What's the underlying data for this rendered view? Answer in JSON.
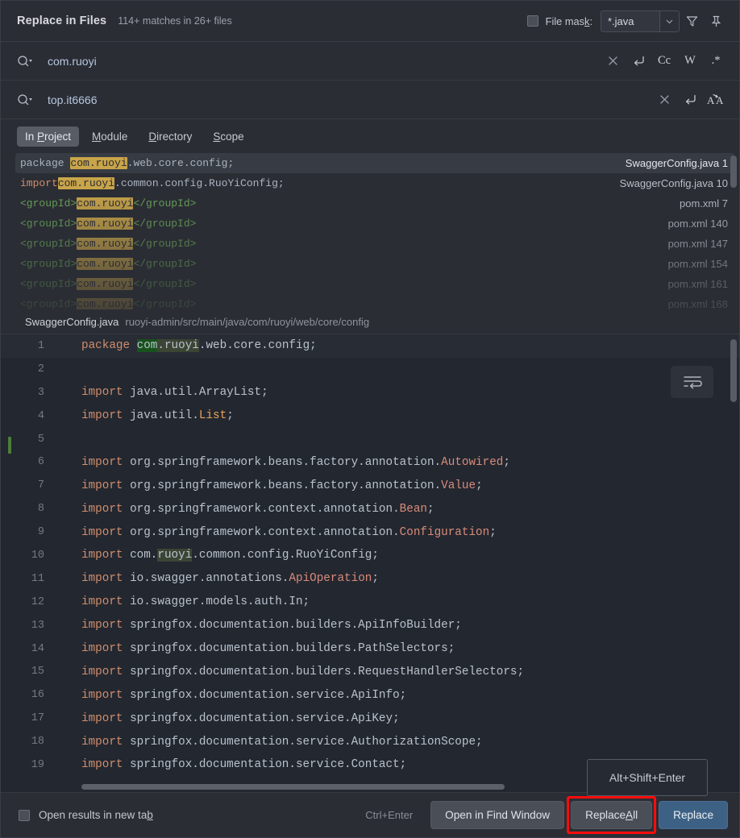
{
  "header": {
    "title": "Replace in Files",
    "match_summary": "114+ matches in 26+ files",
    "file_mask_label_pre": "File mas",
    "file_mask_label_accel": "k",
    "file_mask_label_post": ":",
    "file_mask_value": "*.java",
    "filter_icon": "filter-icon",
    "pin_icon": "pin-icon"
  },
  "search": {
    "value": "com.ruoyi",
    "magnifier_icon": "search-history-icon",
    "clear_icon": "clear-icon",
    "newline_icon": "new-line-icon",
    "match_case_label": "Cc",
    "words_label": "W",
    "regex_label": ".*"
  },
  "replace": {
    "value": "top.it6666",
    "magnifier_icon": "replace-history-icon",
    "clear_icon": "clear-icon",
    "newline_icon": "new-line-icon",
    "preserve_case_label": "A↘A"
  },
  "scope_tabs": [
    {
      "pre": "In ",
      "accel": "P",
      "post": "roject",
      "active": true
    },
    {
      "pre": "",
      "accel": "M",
      "post": "odule",
      "active": false
    },
    {
      "pre": "",
      "accel": "D",
      "post": "irectory",
      "active": false
    },
    {
      "pre": "",
      "accel": "S",
      "post": "cope",
      "active": false
    }
  ],
  "results": [
    {
      "selected": true,
      "parts": [
        {
          "t": "package ",
          "c": "plain"
        },
        {
          "t": "com.ruoyi",
          "c": "hl"
        },
        {
          "t": ".web.core.config;",
          "c": "plain"
        }
      ],
      "file": "SwaggerConfig.java",
      "line": "1"
    },
    {
      "selected": false,
      "parts": [
        {
          "t": "import",
          "c": "kw"
        },
        {
          "t": "com.ruoyi",
          "c": "hl"
        },
        {
          "t": ".common.config.RuoYiConfig;",
          "c": "plain"
        }
      ],
      "file": "SwaggerConfig.java",
      "line": "10"
    },
    {
      "selected": false,
      "parts": [
        {
          "t": "<groupId>",
          "c": "tag"
        },
        {
          "t": "com.ruoyi",
          "c": "hl"
        },
        {
          "t": "</groupId>",
          "c": "tag"
        }
      ],
      "file": "pom.xml",
      "line": "7"
    },
    {
      "selected": false,
      "parts": [
        {
          "t": "<groupId>",
          "c": "tag"
        },
        {
          "t": "com.ruoyi",
          "c": "hl"
        },
        {
          "t": "</groupId>",
          "c": "tag"
        }
      ],
      "file": "pom.xml",
      "line": "140"
    },
    {
      "selected": false,
      "parts": [
        {
          "t": "<groupId>",
          "c": "tag"
        },
        {
          "t": "com.ruoyi",
          "c": "hl"
        },
        {
          "t": "</groupId>",
          "c": "tag"
        }
      ],
      "file": "pom.xml",
      "line": "147"
    },
    {
      "selected": false,
      "parts": [
        {
          "t": "<groupId>",
          "c": "tag"
        },
        {
          "t": "com.ruoyi",
          "c": "hl"
        },
        {
          "t": "</groupId>",
          "c": "tag"
        }
      ],
      "file": "pom.xml",
      "line": "154"
    },
    {
      "selected": false,
      "parts": [
        {
          "t": "<groupId>",
          "c": "tag"
        },
        {
          "t": "com.ruoyi",
          "c": "hl"
        },
        {
          "t": "</groupId>",
          "c": "tag"
        }
      ],
      "file": "pom.xml",
      "line": "161"
    },
    {
      "selected": false,
      "parts": [
        {
          "t": "<groupId>",
          "c": "tag"
        },
        {
          "t": "com.ruoyi",
          "c": "hl"
        },
        {
          "t": "</groupId>",
          "c": "tag"
        }
      ],
      "file": "pom.xml",
      "line": "168"
    }
  ],
  "preview": {
    "file_name": "SwaggerConfig.java",
    "file_dir": "ruoyi-admin/src/main/java/com/ruoyi/web/core/config",
    "soft_wrap_icon": "soft-wrap-icon",
    "lines": [
      {
        "n": "1",
        "current": true,
        "marked": false,
        "parts": [
          {
            "t": "package ",
            "c": "c-kw"
          },
          {
            "t": "com",
            "c": "c-txt c-hl-strong"
          },
          {
            "t": ".ruoyi",
            "c": "c-txt c-hl-soft"
          },
          {
            "t": ".web.core.config;",
            "c": "c-txt"
          }
        ]
      },
      {
        "n": "2",
        "current": false,
        "marked": false,
        "parts": []
      },
      {
        "n": "3",
        "current": false,
        "marked": false,
        "parts": [
          {
            "t": "import ",
            "c": "c-kw"
          },
          {
            "t": "java.util.ArrayList;",
            "c": "c-txt"
          }
        ]
      },
      {
        "n": "4",
        "current": false,
        "marked": false,
        "parts": [
          {
            "t": "import ",
            "c": "c-kw"
          },
          {
            "t": "java.util.",
            "c": "c-txt"
          },
          {
            "t": "List",
            "c": "c-type"
          },
          {
            "t": ";",
            "c": "c-txt"
          }
        ]
      },
      {
        "n": "5",
        "current": false,
        "marked": true,
        "parts": []
      },
      {
        "n": "6",
        "current": false,
        "marked": false,
        "parts": [
          {
            "t": "import ",
            "c": "c-kw"
          },
          {
            "t": "org.springframework.beans.factory.annotation.",
            "c": "c-txt"
          },
          {
            "t": "Autowired",
            "c": "c-cls"
          },
          {
            "t": ";",
            "c": "c-txt"
          }
        ]
      },
      {
        "n": "7",
        "current": false,
        "marked": false,
        "parts": [
          {
            "t": "import ",
            "c": "c-kw"
          },
          {
            "t": "org.springframework.beans.factory.annotation.",
            "c": "c-txt"
          },
          {
            "t": "Value",
            "c": "c-cls"
          },
          {
            "t": ";",
            "c": "c-txt"
          }
        ]
      },
      {
        "n": "8",
        "current": false,
        "marked": false,
        "parts": [
          {
            "t": "import ",
            "c": "c-kw"
          },
          {
            "t": "org.springframework.context.annotation.",
            "c": "c-txt"
          },
          {
            "t": "Bean",
            "c": "c-cls"
          },
          {
            "t": ";",
            "c": "c-txt"
          }
        ]
      },
      {
        "n": "9",
        "current": false,
        "marked": false,
        "parts": [
          {
            "t": "import ",
            "c": "c-kw"
          },
          {
            "t": "org.springframework.context.annotation.",
            "c": "c-txt"
          },
          {
            "t": "Configuration",
            "c": "c-cls"
          },
          {
            "t": ";",
            "c": "c-txt"
          }
        ]
      },
      {
        "n": "10",
        "current": false,
        "marked": false,
        "parts": [
          {
            "t": "import ",
            "c": "c-kw"
          },
          {
            "t": "com.",
            "c": "c-txt"
          },
          {
            "t": "ruoyi",
            "c": "c-txt c-hl-soft"
          },
          {
            "t": ".common.config.RuoYiConfig;",
            "c": "c-txt"
          }
        ]
      },
      {
        "n": "11",
        "current": false,
        "marked": false,
        "parts": [
          {
            "t": "import ",
            "c": "c-kw"
          },
          {
            "t": "io.swagger.annotations.",
            "c": "c-txt"
          },
          {
            "t": "ApiOperation",
            "c": "c-cls"
          },
          {
            "t": ";",
            "c": "c-txt"
          }
        ]
      },
      {
        "n": "12",
        "current": false,
        "marked": false,
        "parts": [
          {
            "t": "import ",
            "c": "c-kw"
          },
          {
            "t": "io.swagger.models.auth.In;",
            "c": "c-txt"
          }
        ]
      },
      {
        "n": "13",
        "current": false,
        "marked": false,
        "parts": [
          {
            "t": "import ",
            "c": "c-kw"
          },
          {
            "t": "springfox.documentation.builders.ApiInfoBuilder;",
            "c": "c-txt"
          }
        ]
      },
      {
        "n": "14",
        "current": false,
        "marked": false,
        "parts": [
          {
            "t": "import ",
            "c": "c-kw"
          },
          {
            "t": "springfox.documentation.builders.PathSelectors;",
            "c": "c-txt"
          }
        ]
      },
      {
        "n": "15",
        "current": false,
        "marked": false,
        "parts": [
          {
            "t": "import ",
            "c": "c-kw"
          },
          {
            "t": "springfox.documentation.builders.RequestHandlerSelectors;",
            "c": "c-txt"
          }
        ]
      },
      {
        "n": "16",
        "current": false,
        "marked": false,
        "parts": [
          {
            "t": "import ",
            "c": "c-kw"
          },
          {
            "t": "springfox.documentation.service.ApiInfo;",
            "c": "c-txt"
          }
        ]
      },
      {
        "n": "17",
        "current": false,
        "marked": false,
        "parts": [
          {
            "t": "import ",
            "c": "c-kw"
          },
          {
            "t": "springfox.documentation.service.ApiKey;",
            "c": "c-txt"
          }
        ]
      },
      {
        "n": "18",
        "current": false,
        "marked": false,
        "parts": [
          {
            "t": "import ",
            "c": "c-kw"
          },
          {
            "t": "springfox.documentation.service.AuthorizationScope;",
            "c": "c-txt"
          }
        ]
      },
      {
        "n": "19",
        "current": false,
        "marked": false,
        "parts": [
          {
            "t": "import ",
            "c": "c-kw"
          },
          {
            "t": "springfox.documentation.service.Contact;",
            "c": "c-txt"
          }
        ]
      }
    ]
  },
  "tooltip": {
    "text": "Alt+Shift+Enter"
  },
  "footer": {
    "open_new_tab_pre": "Open results in new ta",
    "open_new_tab_accel": "b",
    "shortcut": "Ctrl+Enter",
    "open_find_window": "Open in Find Window",
    "replace_all_pre": "Replace ",
    "replace_all_accel": "A",
    "replace_all_post": "ll",
    "replace": "Replace"
  },
  "colors": {
    "accent_primary": "#3d6185",
    "highlight_match": "#c9a54a",
    "annotation_red": "#fa0c0c",
    "dialog_bg": "#2b2d34",
    "editor_bg": "#232730"
  }
}
